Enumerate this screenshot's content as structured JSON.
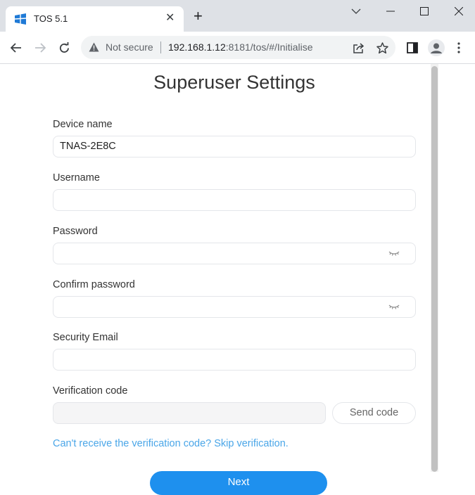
{
  "browser": {
    "tab": {
      "title": "TOS 5.1",
      "close_glyph": "✕",
      "favicon": "window-icon"
    },
    "new_tab_glyph": "+",
    "address_bar": {
      "security_label": "Not secure",
      "url_host": "192.168.1.12",
      "url_rest": ":8181/tos/#/Initialise"
    }
  },
  "page": {
    "title": "Superuser Settings",
    "fields": {
      "device_name": {
        "label": "Device name",
        "value": "TNAS-2E8C"
      },
      "username": {
        "label": "Username",
        "value": ""
      },
      "password": {
        "label": "Password",
        "value": ""
      },
      "confirm_password": {
        "label": "Confirm password",
        "value": ""
      },
      "security_email": {
        "label": "Security Email",
        "value": ""
      },
      "verification_code": {
        "label": "Verification code",
        "value": ""
      }
    },
    "send_code_label": "Send code",
    "skip_link_text": "Can't receive the verification code? Skip verification.",
    "next_label": "Next"
  },
  "colors": {
    "primary": "#1e90ee",
    "link": "#4aa6e8",
    "chrome_bg": "#dee1e6"
  }
}
